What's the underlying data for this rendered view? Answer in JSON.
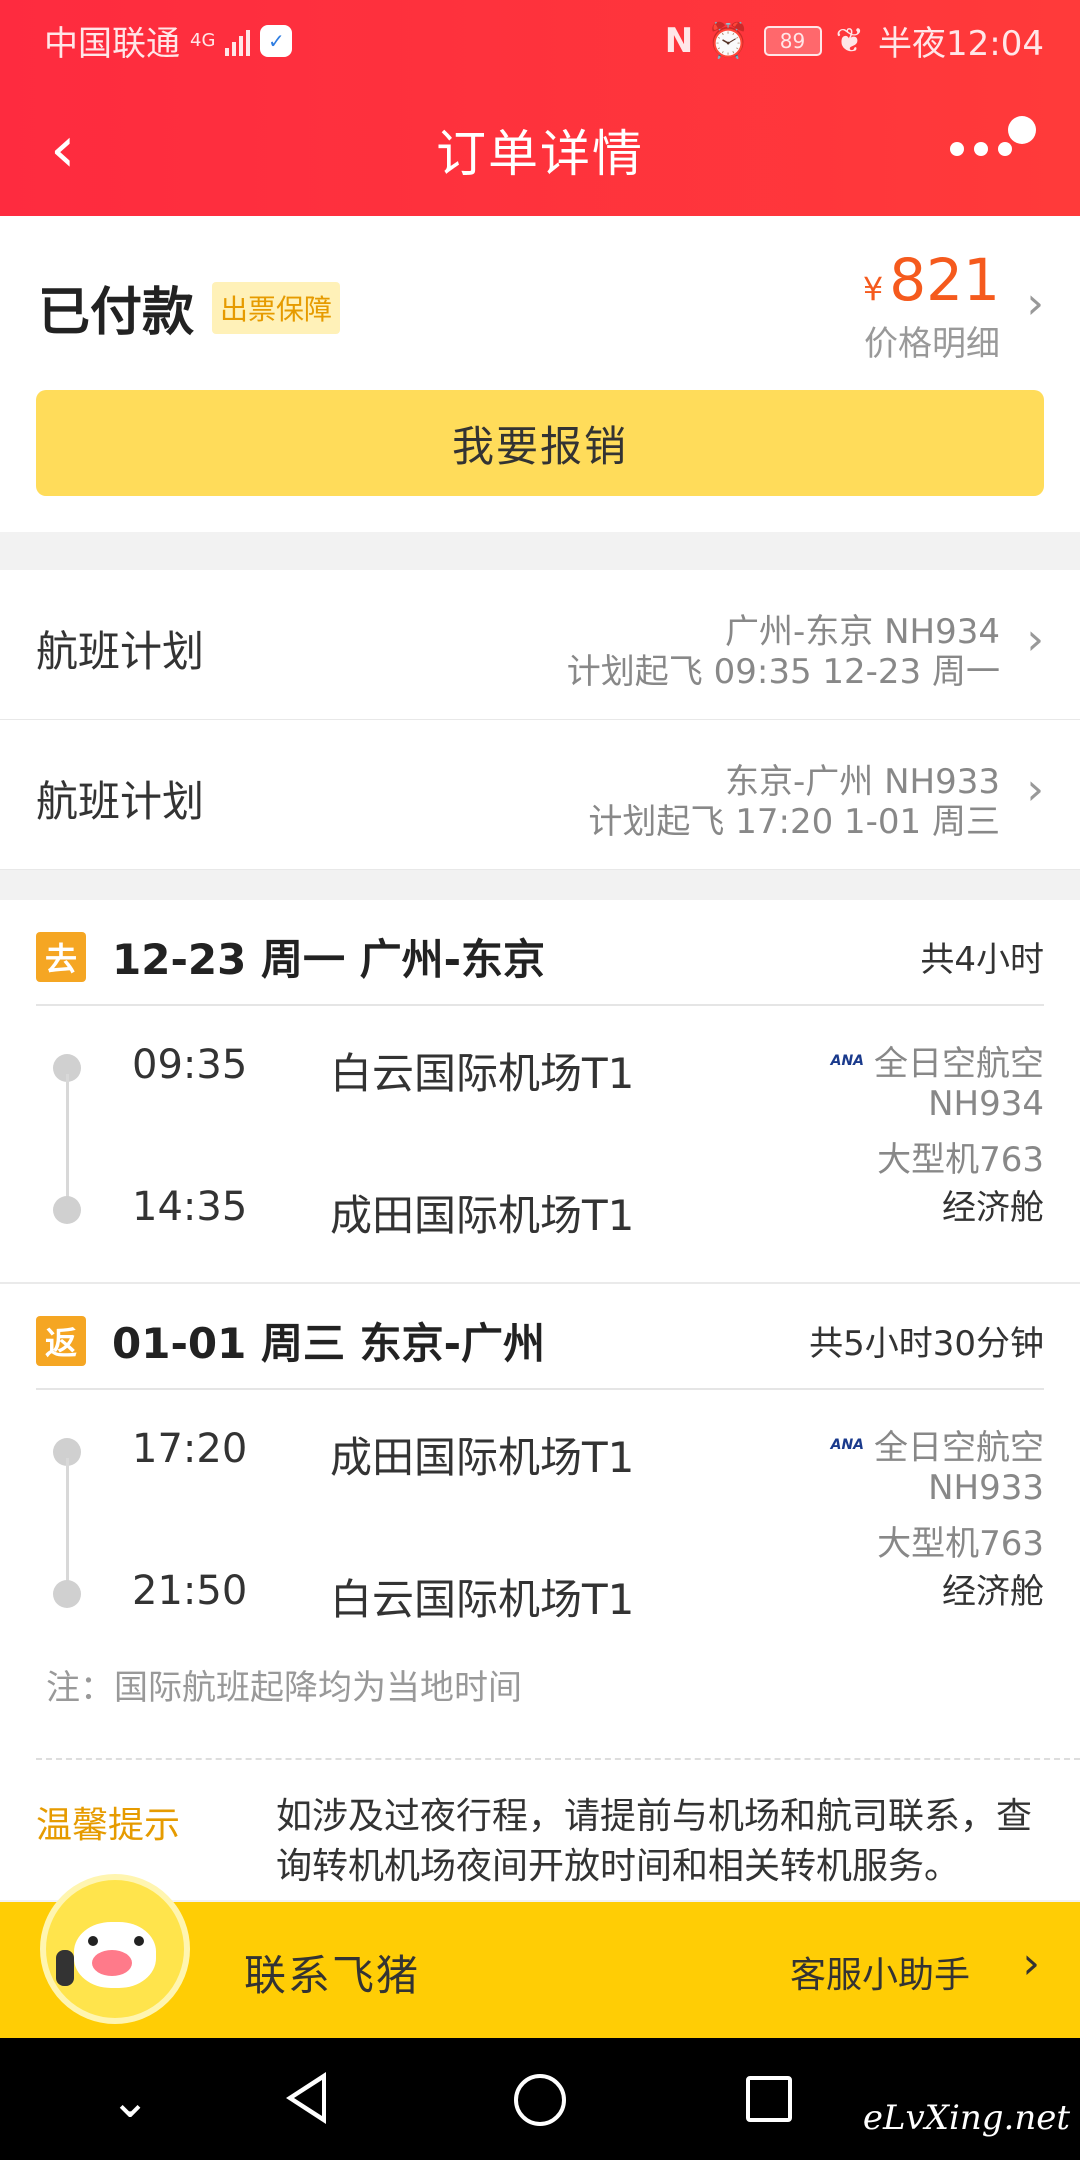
{
  "status_bar": {
    "carrier": "中国联通",
    "network": "4G",
    "battery": "89",
    "time": "半夜12:04"
  },
  "header": {
    "title": "订单详情"
  },
  "payment": {
    "status": "已付款",
    "guarantee_badge": "出票保障",
    "currency_symbol": "¥",
    "amount": "821",
    "price_detail_label": "价格明细",
    "reimburse_button": "我要报销"
  },
  "flight_plans": [
    {
      "label": "航班计划",
      "route": "广州-东京 NH934",
      "departure": "计划起飞 09:35 12-23 周一"
    },
    {
      "label": "航班计划",
      "route": "东京-广州 NH933",
      "departure": "计划起飞 17:20 1-01 周三"
    }
  ],
  "segments": [
    {
      "tag": "去",
      "title": "12-23 周一 广州-东京",
      "duration": "共4小时",
      "dep_time": "09:35",
      "dep_airport": "白云国际机场T1",
      "arr_time": "14:35",
      "arr_airport": "成田国际机场T1",
      "airline_logo": "ANA",
      "airline": "全日空航空",
      "flight_no": "NH934",
      "aircraft": "大型机763",
      "cabin": "经济舱"
    },
    {
      "tag": "返",
      "title": "01-01 周三 东京-广州",
      "duration": "共5小时30分钟",
      "dep_time": "17:20",
      "dep_airport": "成田国际机场T1",
      "arr_time": "21:50",
      "arr_airport": "白云国际机场T1",
      "airline_logo": "ANA",
      "airline": "全日空航空",
      "flight_no": "NH933",
      "aircraft": "大型机763",
      "cabin": "经济舱"
    }
  ],
  "note": "注：国际航班起降均为当地时间",
  "tips": {
    "label": "温馨提示",
    "text": "如涉及过夜行程，请提前与机场和航司联系，查询转机机场夜间开放时间和相关转机服务。"
  },
  "contact_bar": {
    "label": "联系飞猪",
    "assistant": "客服小助手"
  },
  "watermark": "eLvXing.net"
}
